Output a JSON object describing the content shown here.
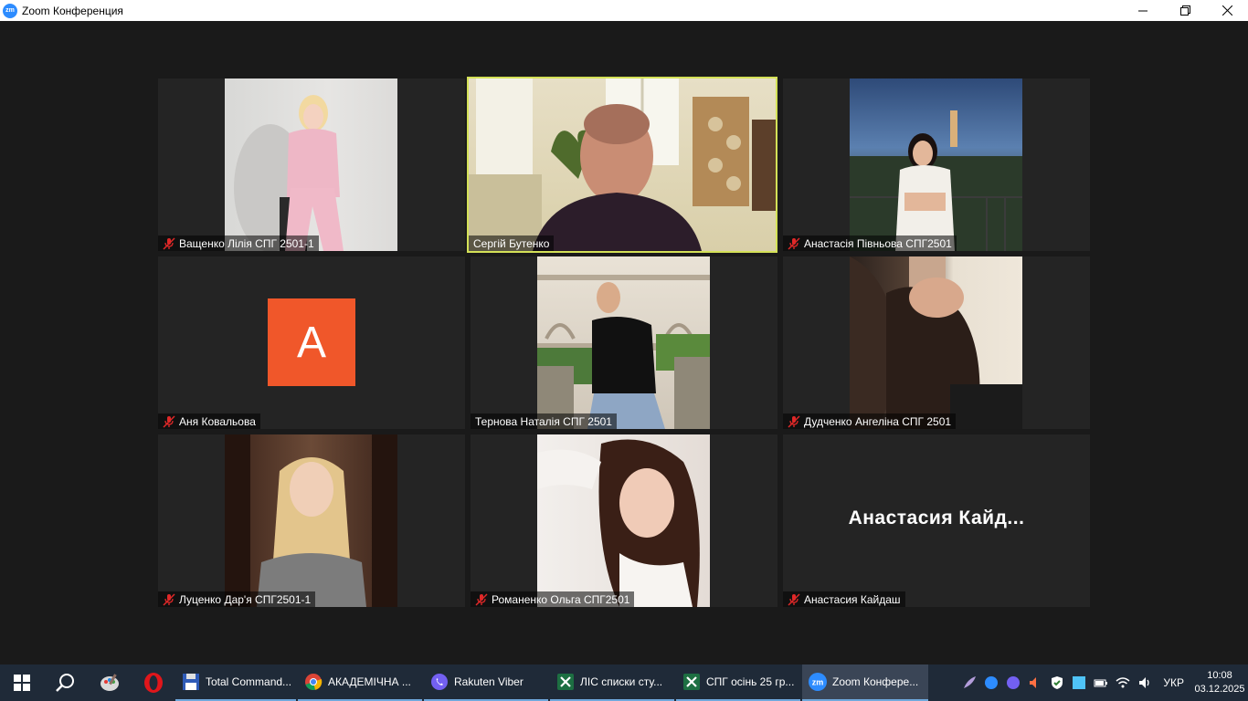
{
  "window": {
    "title": "Zoom Конференция",
    "icon_text": "zm"
  },
  "participants": [
    {
      "name": "Ващенко Лілія СПГ 2501-1",
      "muted": true
    },
    {
      "name": "Сергій Бутенко",
      "muted": false,
      "active_speaker": true
    },
    {
      "name": "Анастасія Півньова СПГ2501",
      "muted": true
    },
    {
      "name": "Аня Ковальова",
      "muted": true,
      "avatar_letter": "A"
    },
    {
      "name": "Тернова Наталія СПГ 2501",
      "muted": false
    },
    {
      "name": "Дудченко Ангеліна СПГ 2501",
      "muted": true
    },
    {
      "name": "Луценко Дар'я СПГ2501-1",
      "muted": true
    },
    {
      "name": "Романенко Ольга СПГ2501",
      "muted": true
    },
    {
      "name": "Анастасия Кайдаш",
      "muted": true,
      "display_name": "Анастасия  Кайд..."
    }
  ],
  "taskbar": {
    "apps": [
      {
        "label": "Total Command...",
        "icon": "floppy-icon"
      },
      {
        "label": "АКАДЕМІЧНА ...",
        "icon": "chrome-icon"
      },
      {
        "label": "Rakuten Viber",
        "icon": "viber-icon"
      },
      {
        "label": "ЛІС списки сту...",
        "icon": "excel-icon"
      },
      {
        "label": "СПГ осінь 25 гр...",
        "icon": "excel-icon"
      },
      {
        "label": "Zoom Конфере...",
        "icon": "zoom-icon"
      }
    ],
    "language": "УКР",
    "time": "10:08",
    "date": "03.12.2025"
  },
  "colors": {
    "active_speaker": "#d4e157",
    "avatar_bg": "#f0572a",
    "taskbar_bg": "#1f2a38",
    "mute_red": "#e02828"
  }
}
